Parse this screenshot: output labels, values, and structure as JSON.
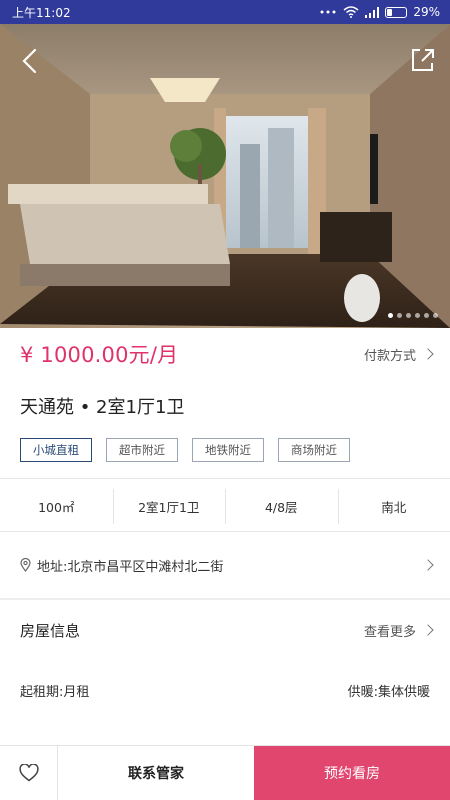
{
  "status_bar": {
    "time": "上午11:02",
    "battery": "29%"
  },
  "gallery": {
    "image_count": 6,
    "active_index": 0
  },
  "price": {
    "amount": "¥ 1000.00元/月",
    "payment_label": "付款方式"
  },
  "listing": {
    "title": "天通苑 • 2室1厅1卫",
    "tags": [
      "小城直租",
      "超市附近",
      "地铁附近",
      "商场附近"
    ]
  },
  "specs": [
    "100㎡",
    "2室1厅1卫",
    "4/8层",
    "南北"
  ],
  "address": {
    "label": "地址:北京市昌平区中滩村北二街"
  },
  "house_info": {
    "title": "房屋信息",
    "more_label": "查看更多",
    "rent_term": "起租期:月租",
    "heating": "供暖:集体供暖"
  },
  "bottom_bar": {
    "contact_label": "联系管家",
    "book_label": "预约看房"
  },
  "colors": {
    "status_bar_bg": "#2f3a9a",
    "price": "#e0336a",
    "primary_tag": "#2a4a77",
    "book_button": "#e0466e"
  }
}
